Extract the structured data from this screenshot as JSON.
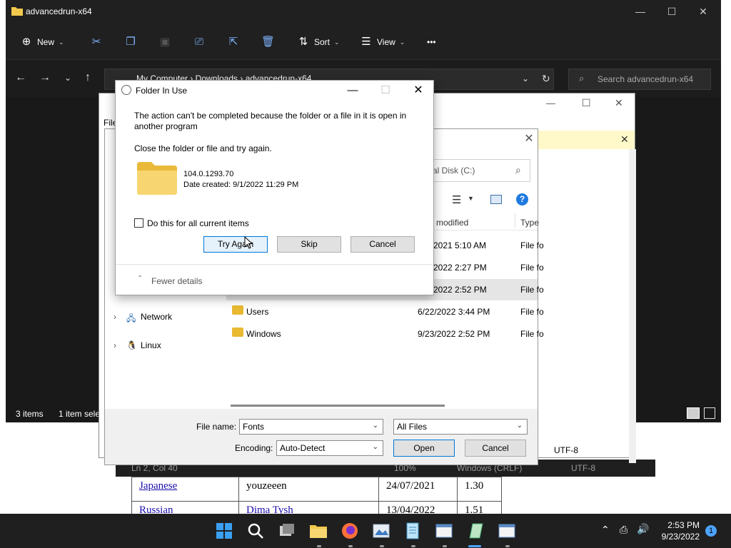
{
  "background_page": {
    "table_rows": [
      {
        "lang": "Japanese",
        "author": "youzeeen",
        "date": "24/07/2021",
        "version": "1.30"
      },
      {
        "lang": "Russian",
        "author": "Dima Tysh",
        "date": "13/04/2022",
        "version": "1.51"
      }
    ]
  },
  "notepad": {
    "status_pos": "Ln 2, Col 40",
    "status_zoom": "100%",
    "status_eol": "Windows (CRLF)",
    "status_enc": "UTF-8",
    "menu_file": "File",
    "enc_label": "UTF-8"
  },
  "explorer": {
    "title": "advancedrun-x64",
    "toolbar": {
      "new": "New",
      "sort": "Sort",
      "view": "View",
      "more": "•••"
    },
    "address": "My Computer  ›  Downloads  ›  advancedrun-x64",
    "search_placeholder": "Search advancedrun-x64",
    "status_items": "3 items",
    "status_selected": "1 item sele"
  },
  "open_dialog": {
    "search_text": "al Disk (C:)",
    "col_modified": "modified",
    "col_type": "Type",
    "rows": [
      {
        "name": "",
        "date": "2021 5:10 AM",
        "type": "File fo"
      },
      {
        "name": "",
        "date": "2022 2:27 PM",
        "type": "File fo"
      },
      {
        "name": "",
        "date": "2022 2:52 PM",
        "type": "File fo"
      },
      {
        "name": "Users",
        "date": "6/22/2022 3:44 PM",
        "type": "File fo"
      },
      {
        "name": "Windows",
        "date": "9/23/2022 2:52 PM",
        "type": "File fo"
      }
    ],
    "tree": {
      "network": "Network",
      "linux": "Linux"
    },
    "filename_label": "File name:",
    "filename_value": "Fonts",
    "filter_value": "All Files",
    "encoding_label": "Encoding:",
    "encoding_value": "Auto-Detect",
    "open_button": "Open",
    "cancel_button": "Cancel"
  },
  "folder_in_use": {
    "title": "Folder In Use",
    "message": "The action can't be completed because the folder or a file in it is open in another program",
    "instruction": "Close the folder or file and try again.",
    "folder_name": "104.0.1293.70",
    "date_created": "Date created: 9/1/2022 11:29 PM",
    "checkbox_label": "Do this for all current items",
    "try_again": "Try Again",
    "skip": "Skip",
    "cancel": "Cancel",
    "fewer_details": "Fewer details"
  },
  "taskbar": {
    "time": "2:53 PM",
    "date": "9/23/2022",
    "notification_count": "1"
  },
  "colors": {
    "accent": "#0078d7",
    "folder_yellow": "#f2c94c",
    "explorer_bg": "#191919",
    "taskbar_bg": "#1f1f1f"
  }
}
